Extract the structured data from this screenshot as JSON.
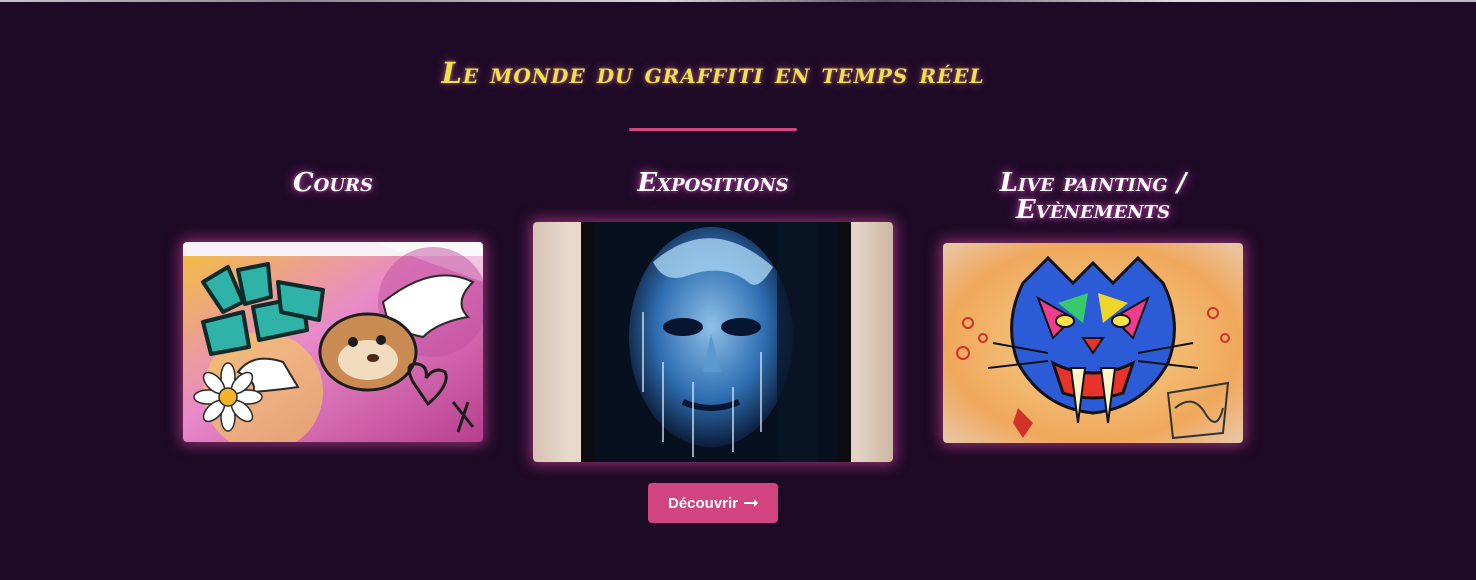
{
  "section": {
    "title": "Le monde du graffiti en temps réel"
  },
  "cards": [
    {
      "title": "Cours",
      "image_subject": "graffiti wall with winged ferret and daisy"
    },
    {
      "title": "Expositions",
      "image_subject": "framed blue drip portrait"
    },
    {
      "title": "Live painting / Evènements",
      "image_subject": "colorful sabre-tooth tiger graffiti"
    }
  ],
  "cta": {
    "label": "Découvrir",
    "icon": "arrow-right-icon"
  },
  "colors": {
    "background": "#1d0a26",
    "title_yellow": "#f2e04c",
    "accent_pink": "#d2457f",
    "glow_pink": "#e84eaa"
  }
}
